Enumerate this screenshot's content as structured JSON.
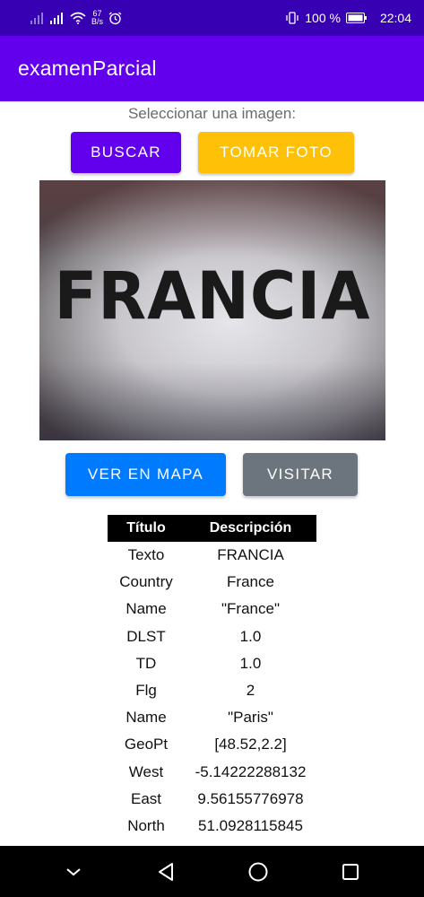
{
  "status_bar": {
    "net_speed_value": "67",
    "net_speed_unit": "B/s",
    "battery_percent": "100 %",
    "time": "22:04",
    "icons": [
      "signal-icon",
      "signal-icon",
      "wifi-icon",
      "alarm-icon",
      "vibrate-icon",
      "battery-icon"
    ]
  },
  "app_bar": {
    "title": "examenParcial"
  },
  "main": {
    "prompt": "Seleccionar una imagen:",
    "buscar_label": "BUSCAR",
    "tomar_foto_label": "TOMAR FOTO",
    "photo_text": "FRANCIA",
    "ver_en_mapa_label": "VER EN MAPA",
    "visitar_label": "VISITAR"
  },
  "table": {
    "headers": [
      "Título",
      "Descripción"
    ],
    "rows": [
      [
        "Texto",
        "FRANCIA"
      ],
      [
        "Country",
        "France"
      ],
      [
        "Name",
        "\"France\""
      ],
      [
        "DLST",
        "1.0"
      ],
      [
        "TD",
        "1.0"
      ],
      [
        "Flg",
        "2"
      ],
      [
        "Name",
        "\"Paris\""
      ],
      [
        "GeoPt",
        "[48.52,2.2]"
      ],
      [
        "West",
        "-5.14222288132"
      ],
      [
        "East",
        "9.56155776978"
      ],
      [
        "North",
        "51.0928115845"
      ]
    ]
  },
  "nav_bar": {
    "icons": [
      "chevron-down-icon",
      "back-icon",
      "home-icon",
      "recents-icon"
    ]
  },
  "colors": {
    "status_bar": "#3700b3",
    "app_bar": "#6200ee",
    "buscar": "#6200ee",
    "tomar_foto": "#ffc107",
    "ver_en_mapa": "#007bff",
    "visitar": "#6c757d"
  }
}
